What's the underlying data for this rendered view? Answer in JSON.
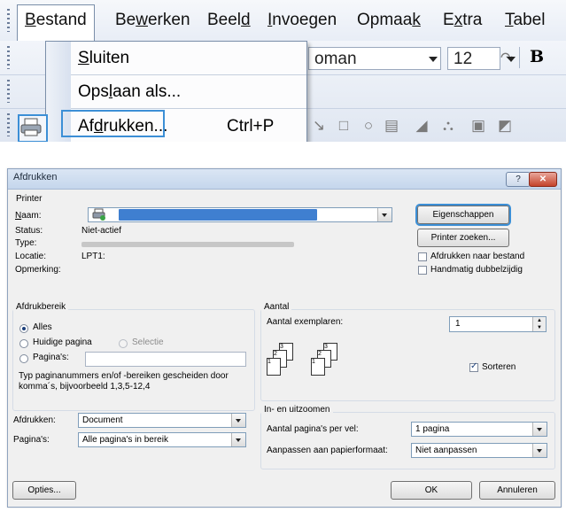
{
  "menu": {
    "items": [
      {
        "label_pre": "",
        "label_u": "B",
        "label_post": "estand"
      },
      {
        "label_pre": "Be",
        "label_u": "w",
        "label_post": "erken"
      },
      {
        "label_pre": "Beel",
        "label_u": "d",
        "label_post": ""
      },
      {
        "label_pre": "",
        "label_u": "I",
        "label_post": "nvoegen"
      },
      {
        "label_pre": "Opmaa",
        "label_u": "k",
        "label_post": ""
      },
      {
        "label_pre": "E",
        "label_u": "x",
        "label_post": "tra"
      },
      {
        "label_pre": "",
        "label_u": "T",
        "label_post": "abel"
      }
    ],
    "dropdown": {
      "close_u": "S",
      "close_rest": "luiten",
      "saveas_pre": "Ops",
      "saveas_u": "l",
      "saveas_post": "aan als...",
      "print_pre": "Af",
      "print_u": "d",
      "print_post": "rukken...",
      "print_shortcut": "Ctrl+P"
    },
    "toolbar": {
      "font_name": "oman",
      "font_size": "12",
      "bold": "B"
    }
  },
  "dialog": {
    "title": "Afdrukken",
    "help": "?",
    "close": "✕",
    "printer": {
      "group": "Printer",
      "name_label": "Naam:",
      "status_label": "Status:",
      "status_value": "Niet-actief",
      "type_label": "Type:",
      "location_label": "Locatie:",
      "location_value": "LPT1:",
      "comment_label": "Opmerking:",
      "properties_button": "Eigenschappen",
      "find_button": "Printer zoeken...",
      "print_to_file": "Afdrukken naar bestand",
      "manual_duplex": "Handmatig dubbelzijdig"
    },
    "range": {
      "group": "Afdrukbereik",
      "all": "Alles",
      "current": "Huidige pagina",
      "selection": "Selectie",
      "pages": "Pagina's:",
      "hint": "Typ paginanummers en/of -bereiken gescheiden door komma´s, bijvoorbeeld 1,3,5-12,4"
    },
    "copies": {
      "group": "Aantal",
      "count_label": "Aantal exemplaren:",
      "count_value": "1",
      "collate": "Sorteren",
      "page_labels": [
        "3",
        "2",
        "1",
        "3",
        "2",
        "1"
      ]
    },
    "zoom": {
      "group": "In- en uitzoomen",
      "per_sheet_label": "Aantal pagina's per vel:",
      "per_sheet_value": "1 pagina",
      "scale_label": "Aanpassen aan papierformaat:",
      "scale_value": "Niet aanpassen"
    },
    "print_what_label": "Afdrukken:",
    "print_what_value": "Document",
    "print_label": "Pagina's:",
    "print_value": "Alle pagina's in bereik",
    "options_button": "Opties...",
    "ok_button": "OK",
    "cancel_button": "Annuleren"
  }
}
